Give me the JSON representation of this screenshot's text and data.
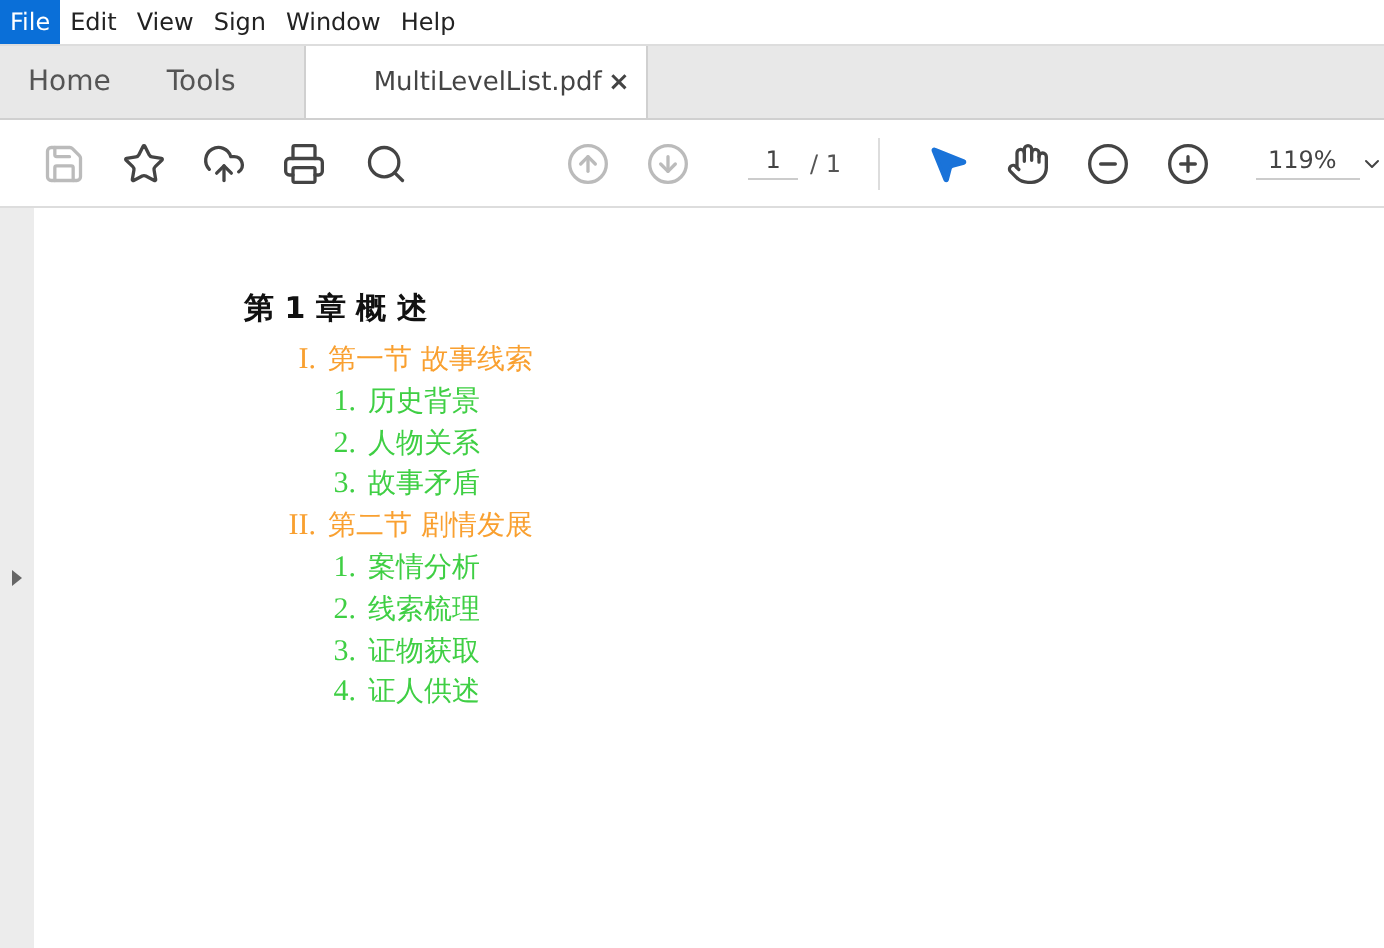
{
  "menu": [
    {
      "label": "File",
      "selected": true
    },
    {
      "label": "Edit",
      "selected": false
    },
    {
      "label": "View",
      "selected": false
    },
    {
      "label": "Sign",
      "selected": false
    },
    {
      "label": "Window",
      "selected": false
    },
    {
      "label": "Help",
      "selected": false
    }
  ],
  "tabs": [
    {
      "label": "Home",
      "selected": false
    },
    {
      "label": "Tools",
      "selected": false
    }
  ],
  "document_tab": {
    "label": "MultiLevelList.pdf",
    "close": "×",
    "selected": true
  },
  "toolbar": {
    "save_disabled": true,
    "page_up_disabled": true,
    "page_down_disabled": true,
    "page": "1",
    "page_total": "/ 1",
    "zoom": "119%"
  },
  "document": {
    "heading": "第 1 章 概 述",
    "sections": [
      {
        "marker": "I.",
        "title": "第一节 故事线索",
        "children": [
          {
            "marker": "1.",
            "title": "历史背景"
          },
          {
            "marker": "2.",
            "title": "人物关系"
          },
          {
            "marker": "3.",
            "title": "故事矛盾"
          }
        ]
      },
      {
        "marker": "II.",
        "title": "第二节 剧情发展",
        "children": [
          {
            "marker": "1.",
            "title": "案情分析"
          },
          {
            "marker": "2.",
            "title": "线索梳理"
          },
          {
            "marker": "3.",
            "title": "证物获取"
          },
          {
            "marker": "4.",
            "title": "证人供述"
          }
        ]
      }
    ]
  }
}
